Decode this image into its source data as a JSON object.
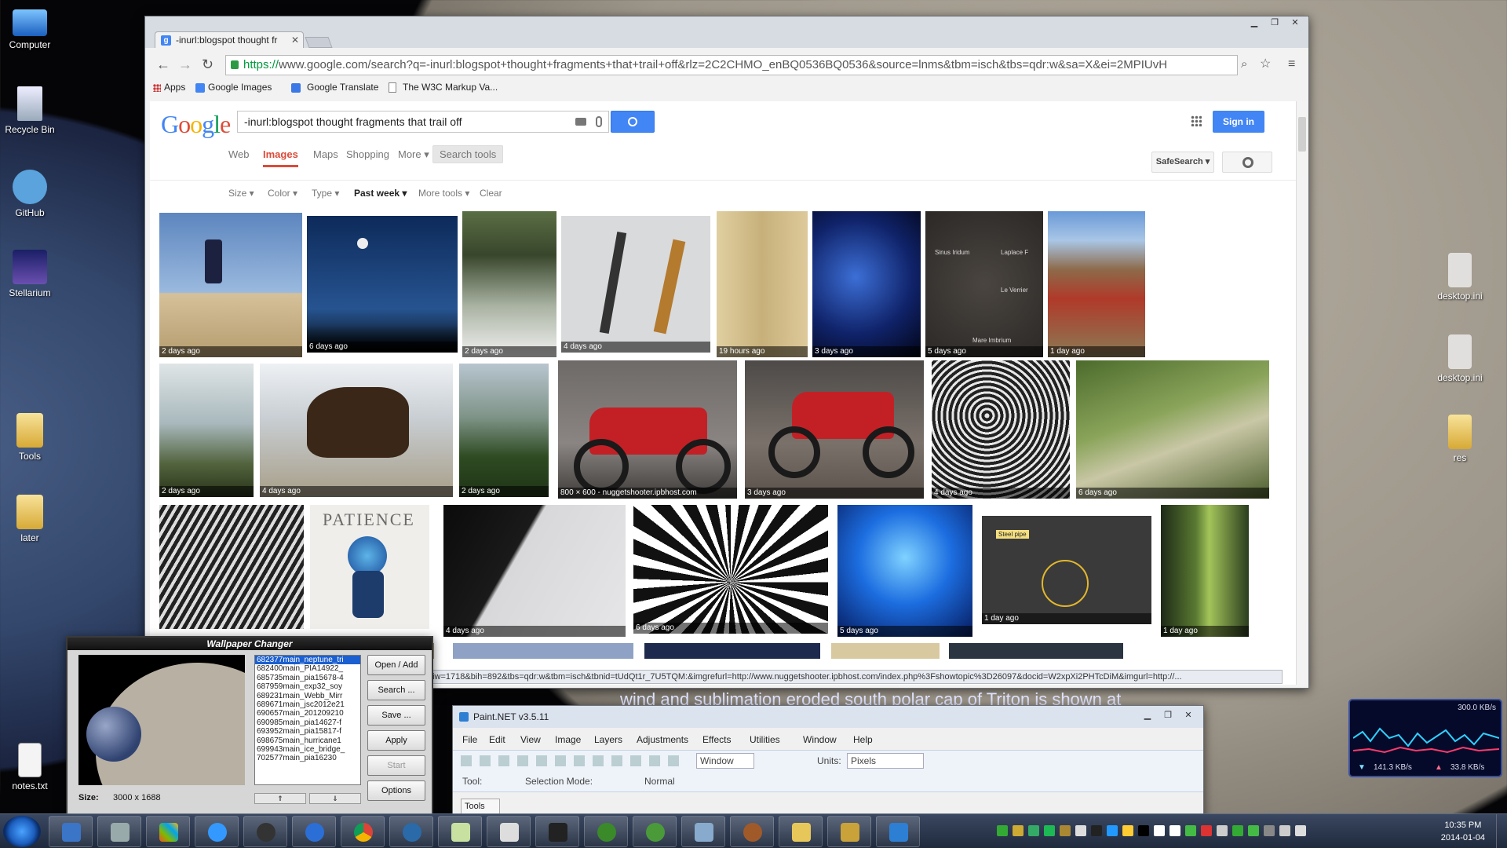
{
  "desktop": {
    "icons_left": [
      "Computer",
      "Recycle Bin",
      "GitHub",
      "Stellarium",
      "Tools",
      "later",
      "notes.txt"
    ],
    "icons_right": [
      "desktop.ini",
      "desktop.ini",
      "res"
    ]
  },
  "chrome": {
    "tab_title": "-inurl:blogspot thought fr",
    "url_https": "https://",
    "url_rest": "www.google.com/search?q=-inurl:blogspot+thought+fragments+that+trail+off&rlz=2C2CHMO_enBQ0536BQ0536&source=lnms&tbm=isch&tbs=qdr:w&sa=X&ei=2MPIUvH",
    "bookmarks": [
      "Apps",
      "Google Images",
      "Google Translate",
      "The W3C Markup Va..."
    ],
    "status_url": "biw=1718&bih=892&tbs=qdr:w&tbm=isch&tbnid=tUdQt1r_7U5TQM:&imgrefurl=http://www.nuggetshooter.ipbhost.com/index.php%3Fshowtopic%3D26097&docid=W2xpXi2PHTcDiM&imgurl=http://..."
  },
  "google": {
    "logo": "Google",
    "query": "-inurl:blogspot thought fragments that trail off",
    "sign_in": "Sign in",
    "tabs": [
      "Web",
      "Images",
      "Maps",
      "Shopping",
      "More ▾",
      "Search tools"
    ],
    "safesearch": "SafeSearch ▾",
    "tools": [
      "Size ▾",
      "Color ▾",
      "Type ▾",
      "Past week ▾",
      "More tools ▾",
      "Clear"
    ],
    "captions": {
      "r1": [
        "2 days ago",
        "6 days ago",
        "2 days ago",
        "4 days ago",
        "19 hours ago",
        "3 days ago",
        "5 days ago",
        "1 day ago"
      ],
      "r2": [
        "2 days ago",
        "4 days ago",
        "2 days ago",
        "800 × 600 - nuggetshooter.ipbhost.com",
        "3 days ago",
        "4 days ago",
        "6 days ago"
      ],
      "r3": [
        "",
        "",
        "4 days ago",
        "6 days ago",
        "5 days ago",
        "1 day ago",
        "1 day ago"
      ]
    },
    "img_text": {
      "patience": "PATIENCE",
      "sinus": "Sinus Iridum",
      "laplace": "Laplace F",
      "leverrier": "Le Verrier",
      "mare": "Mare Imbrium",
      "steel": "Steel pipe"
    }
  },
  "triton_text": "wind and sublimation eroded south polar cap of Triton is shown at",
  "wallpaper": {
    "title": "Wallpaper Changer",
    "files": [
      "682377main_neptune_tri",
      "682400main_PIA14922_",
      "685735main_pia15678-4",
      "687959main_exp32_soy",
      "689231main_Webb_Mirr",
      "689671main_jsc2012e21",
      "690657main_201209210",
      "690985main_pia14627-f",
      "693952main_pia15817-f",
      "698675main_hurricane1",
      "699943main_ice_bridge_",
      "702577main_pia16230"
    ],
    "buttons": [
      "Open / Add",
      "Search ...",
      "Save ...",
      "Apply",
      "Start",
      "Options"
    ],
    "size_label": "Size:",
    "size_value": "3000 x 1688",
    "arrow_up": "⇑",
    "arrow_down": "⇓"
  },
  "paintnet": {
    "title": "Paint.NET v3.5.11",
    "menu": [
      "File",
      "Edit",
      "View",
      "Image",
      "Layers",
      "Adjustments",
      "Effects",
      "Utilities",
      "Window",
      "Help"
    ],
    "window_sel": "Window",
    "units_label": "Units:",
    "units": "Pixels",
    "tool_label": "Tool:",
    "selmode": "Selection Mode:",
    "normal": "Normal",
    "tools_panel": "Tools"
  },
  "netmeter": {
    "top": "300.0 KB/s",
    "down": "141.3 KB/s",
    "up": "33.8 KB/s"
  },
  "clock": {
    "time": "10:35 PM",
    "date": "2014-01-04"
  },
  "colors": {
    "google_blue": "#4285f4",
    "google_red": "#dd4b39",
    "selection": "#1c5fd0"
  }
}
